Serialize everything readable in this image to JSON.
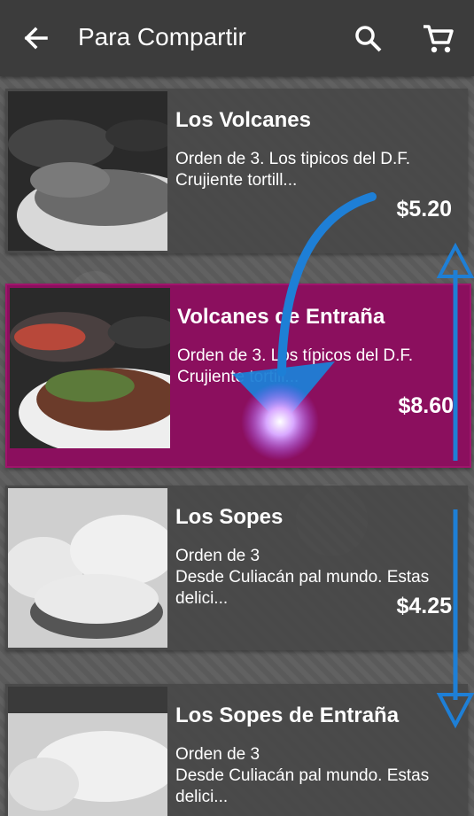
{
  "appbar": {
    "title": "Para Compartir",
    "icons": [
      "back-arrow-icon",
      "search-icon",
      "cart-icon"
    ]
  },
  "items": [
    {
      "name": "Los Volcanes",
      "desc_line1": "Orden de 3. Los tipicos del D.F.",
      "desc_line2": "Crujiente tortill...",
      "price": "$5.20"
    },
    {
      "name": "Volcanes de Entraña",
      "desc_line1": "Orden de 3. Los típicos del D.F.",
      "desc_line2": "Crujiente tortill...",
      "price": "$8.60"
    },
    {
      "name": "Los Sopes",
      "desc_line1": "Orden de 3",
      "desc_line2": "Desde Culiacán pal mundo. Estas delici...",
      "price": "$4.25"
    },
    {
      "name": "Los Sopes de Entraña",
      "desc_line1": "Orden de 3",
      "desc_line2": "Desde Culiacán pal mundo. Estas delici...",
      "price": ""
    }
  ],
  "colors": {
    "appbar": "#3c3c3c",
    "active_card": "#8b0f5e",
    "gesture_arrow": "#1e7fd6"
  }
}
